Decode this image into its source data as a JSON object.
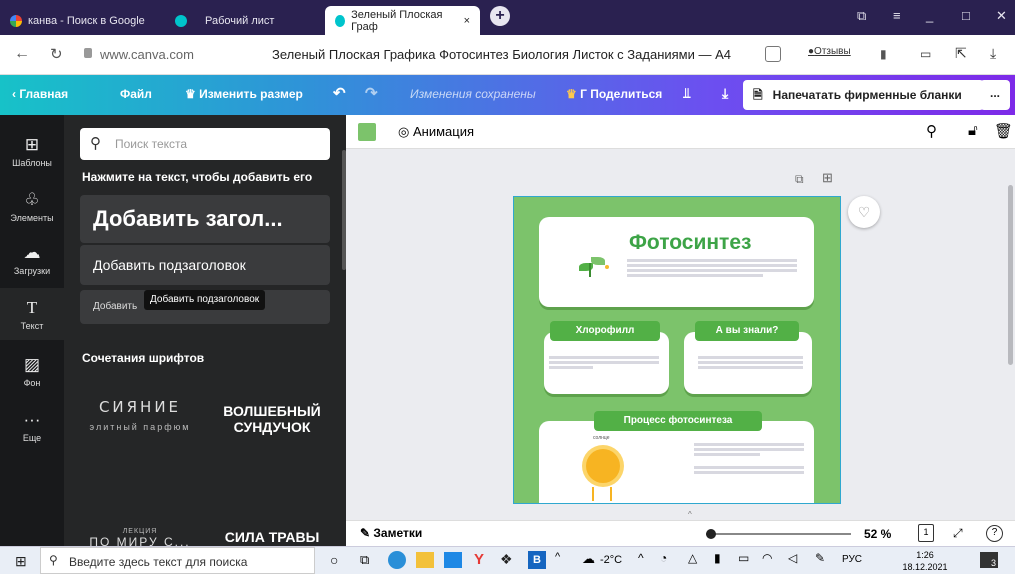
{
  "browser": {
    "tabs": [
      {
        "label": "канва - Поиск в Google"
      },
      {
        "label": "Рабочий лист"
      },
      {
        "label": "Зеленый Плоская Граф"
      }
    ],
    "url": "www.canva.com",
    "page_title": "Зеленый Плоская Графика Фотосинтез Биология Листок с Заданиями — А4",
    "feedback_label": "Отзывы"
  },
  "toolbar": {
    "home": "Главная",
    "file": "Файл",
    "resize": "Изменить размер",
    "saved_status": "Изменения сохранены",
    "share": "Г Поделиться",
    "print": "Напечатать фирменные бланки",
    "more": "..."
  },
  "rail": [
    {
      "label": "Шаблоны"
    },
    {
      "label": "Элементы"
    },
    {
      "label": "Загрузки"
    },
    {
      "label": "Текст"
    },
    {
      "label": "Фон"
    },
    {
      "label": "Еще"
    }
  ],
  "panel": {
    "search_placeholder": "Поиск текста",
    "hint": "Нажмите на текст, чтобы добавить его",
    "add_heading": "Добавить загол...",
    "add_subheading": "Добавить подзаголовок",
    "add_body": "Добавить",
    "tooltip": "Добавить подзаголовок",
    "font_combos_title": "Сочетания шрифтов",
    "combos": [
      {
        "top": "СИЯНИЕ",
        "bottom": "элитный парфюм"
      },
      {
        "top": "ВОЛШЕБНЫЙ",
        "bottom": "СУНДУЧОК"
      },
      {
        "top": "ЛЕКЦИЯ",
        "bottom": "ПО МИРУ С..."
      },
      {
        "top": "СИЛА ТРАВЫ",
        "bottom": ""
      }
    ]
  },
  "canvas": {
    "animation_label": "Анимация",
    "doc_title": "Фотосинтез",
    "box1_title": "Хлорофилл",
    "box2_title": "А вы знали?",
    "box3_title": "Процесс фотосинтеза",
    "sun_label": "солнце",
    "notes_label": "Заметки",
    "zoom": "52 %",
    "page_num": "1",
    "help": "?"
  },
  "taskbar": {
    "search_placeholder": "Введите здесь текст для поиска",
    "weather": "-2°C",
    "lang": "РУС",
    "time": "1:26",
    "date": "18.12.2021",
    "notif_count": "3"
  },
  "colors": {
    "accent_purple": "#7d2ae8",
    "canva_teal": "#17c2c8",
    "doc_green": "#7cc36b",
    "doc_title_green": "#3da447"
  }
}
